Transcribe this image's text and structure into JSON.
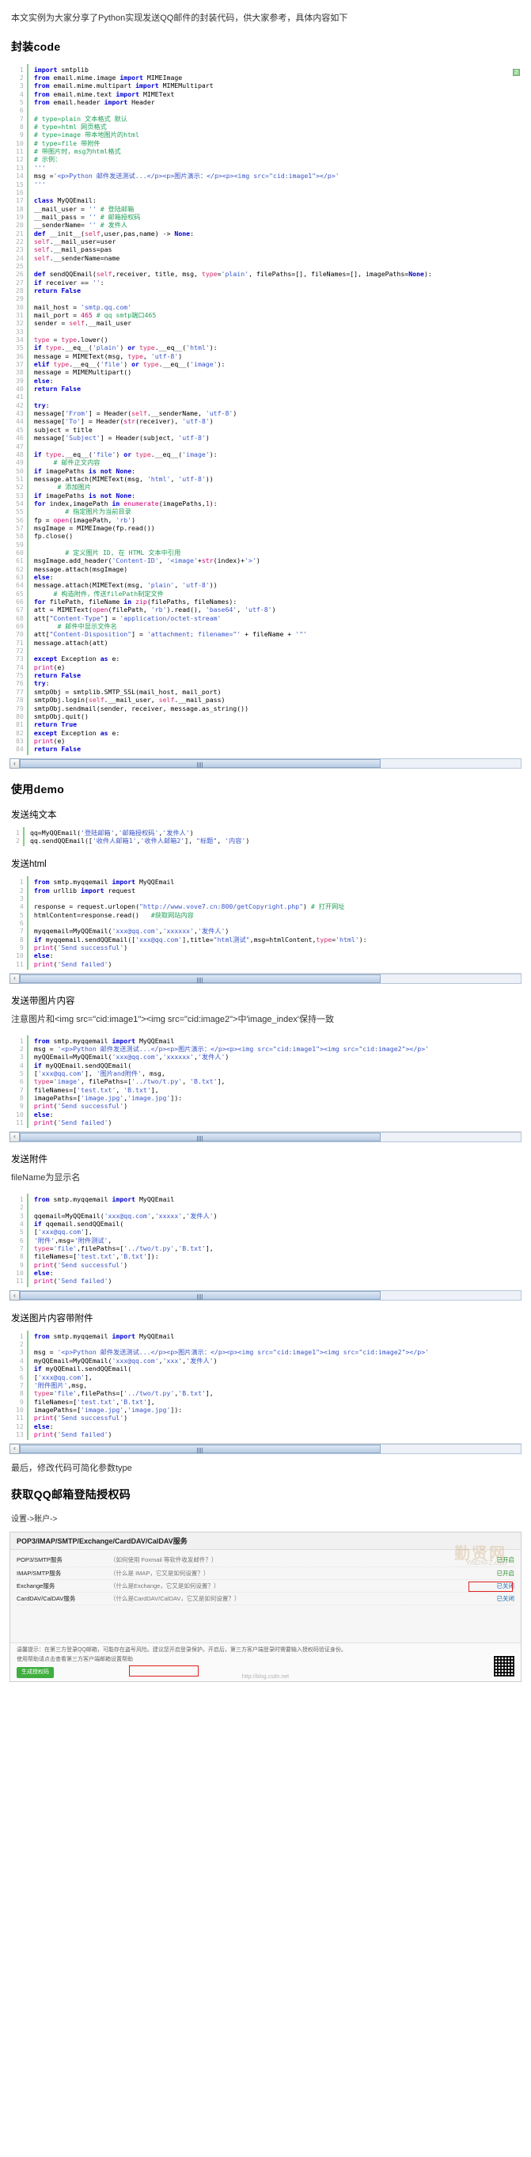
{
  "article": {
    "intro": "本文实例为大家分享了Python实现发送QQ邮件的封装代码，供大家参考，具体内容如下",
    "section1_title": "封装code",
    "section2_title": "使用demo",
    "sub_plain": "发送纯文本",
    "sub_html": "发送html",
    "sub_image": "发送带图片内容",
    "note_image": "注意图片和<img src=\"cid:image1\"><img src=\"cid:image2\">中'image_index'保持一致",
    "sub_file": "发送附件",
    "note_file": "fileName为显示名",
    "sub_image_file": "发送图片内容带附件",
    "tail_note": "最后，修改代码可简化参数type",
    "section3_title": "获取QQ邮箱登陆授权码",
    "path_note": "设置->账户->"
  },
  "scrollbar": {
    "left_arrow": "‹",
    "aria": "horizontal-scrollbar"
  },
  "badge": {
    "label": "2"
  },
  "code_blocks": {
    "main": {
      "first_line": 1,
      "lines": [
        "import smtplib",
        "from email.mime.image import MIMEImage",
        "from email.mime.multipart import MIMEMultipart",
        "from email.mime.text import MIMEText",
        "from email.header import Header",
        "",
        "# type=plain 文本格式 默认",
        "# type=html 网页格式",
        "# type=image 带本地图片的html",
        "# type=file 带附件",
        "# 带图片时，msg为html格式",
        "# 示例：",
        "'''",
        "msg ='<p>Python 邮件发送测试...</p><p>图片演示：</p><p><img src=\"cid:image1\"></p>'",
        "'''",
        "",
        "class MyQQEmail:",
        "  __mail_user = '' # 登陆邮箱",
        "  __mail_pass = '' # 邮箱授权码",
        "  __senderName= '' # 发件人",
        "  def __init__(self,user,pas,name) -> None:",
        "   self.__mail_user=user",
        "   self.__mail_pass=pas",
        "   self.__senderName=name",
        "",
        "  def sendQQEmail(self,receiver, title, msg, type='plain', filePaths=[], fileNames=[], imagePaths=None):",
        "   if receiver == '':",
        "    return False",
        "",
        "   mail_host = 'smtp.qq.com'",
        "   mail_port = 465 # qq smtp端口465",
        "   sender = self.__mail_user",
        "",
        "   type = type.lower()",
        "   if type.__eq__('plain') or type.__eq__('html'):",
        "    message = MIMEText(msg, type, 'utf-8')",
        "   elif type.__eq__('file') or type.__eq__('image'):",
        "    message = MIMEMultipart()",
        "   else:",
        "    return False",
        "",
        "   try:",
        "    message['From'] = Header(self.__senderName, 'utf-8')",
        "    message['To'] = Header(str(receiver), 'utf-8')",
        "    subject = title",
        "    message['Subject'] = Header(subject, 'utf-8')",
        "",
        "    if type.__eq__('file') or type.__eq__('image'):",
        "     # 邮件正文内容",
        "     if imagePaths is not None:",
        "      message.attach(MIMEText(msg, 'html', 'utf-8'))",
        "      # 添加图片",
        "      if imagePaths is not None:",
        "       for index,imagePath in enumerate(imagePaths,1):",
        "        # 指定图片为当前目录",
        "        fp = open(imagePath, 'rb')",
        "        msgImage = MIMEImage(fp.read())",
        "        fp.close()",
        "",
        "        # 定义图片 ID, 在 HTML 文本中引用",
        "        msgImage.add_header('Content-ID', '<image'+str(index)+'>')",
        "        message.attach(msgImage)",
        "     else:",
        "      message.attach(MIMEText(msg, 'plain', 'utf-8'))",
        "     # 构造附件，传送filePath制定文件",
        "     for filePath, fileName in zip(filePaths, fileNames):",
        "      att = MIMEText(open(filePath, 'rb').read(), 'base64', 'utf-8')",
        "      att[\"Content-Type\"] = 'application/octet-stream'",
        "      # 邮件中显示文件名",
        "      att[\"Content-Disposition\"] = 'attachment; filename=\"' + fileName + '\"'",
        "      message.attach(att)",
        "",
        "   except Exception as e:",
        "    print(e)",
        "    return False",
        "   try:",
        "    smtpObj = smtplib.SMTP_SSL(mail_host, mail_port)",
        "    smtpObj.login(self.__mail_user, self.__mail_pass)",
        "    smtpObj.sendmail(sender, receiver, message.as_string())",
        "    smtpObj.quit()",
        "    return True",
        "   except Exception as e:",
        "    print(e)",
        "    return False"
      ]
    },
    "demo_plain": {
      "first_line": 1,
      "lines": [
        "qq=MyQQEmail('登陆邮箱','邮箱授权码','发件人')",
        "qq.sendQQEmail(['收件人邮箱1','收件人邮箱2'], \"标题\", '内容')"
      ]
    },
    "demo_html": {
      "first_line": 1,
      "lines": [
        "from smtp.myqqemail import MyQQEmail",
        "from urllib import request",
        "",
        "response = request.urlopen(\"http://www.vove7.cn:800/getCopyright.php\") # 打开网址",
        "htmlContent=response.read()   #获取网站内容",
        "",
        "myqqemail=MyQQEmail('xxx@qq.com','xxxxxx','发件人')",
        "if myqqemail.sendQQEmail(['xxx@qq.com'],title=\"html测试\",msg=htmlContent,type='html'):",
        "  print('Send successful')",
        "else:",
        "  print('Send failed')"
      ]
    },
    "demo_image": {
      "first_line": 1,
      "lines": [
        "from smtp.myqqemail import MyQQEmail",
        "msg = '<p>Python 邮件发送测试...</p><p>图片演示：</p><p><img src=\"cid:image1\"><img src=\"cid:image2\"></p>'",
        "myQQEmail=MyQQEmail('xxx@qq.com','xxxxxx','发件人')",
        "if myQQEmail.sendQQEmail(",
        "    ['xxx@qq.com'], '图片and附件', msg,",
        "    type='image', filePaths=['../two/t.py', 'B.txt'],",
        "    fileNames=['test.txt', 'B.txt'],",
        "    imagePaths=['image.jpg','image.jpg']):",
        "  print('Send successful')",
        "else:",
        "  print('Send failed')"
      ]
    },
    "demo_file": {
      "first_line": 1,
      "lines": [
        "from smtp.myqqemail import MyQQEmail",
        "",
        "qqemail=MyQQEmail('xxx@qq.com','xxxxx','发件人')",
        "if qqemail.sendQQEmail(",
        "    ['xxx@qq.com'],",
        "    '附件',msg='附件测试',",
        "    type='file',filePaths=['../two/t.py','B.txt'],",
        "    fileNames=['test.txt','B.txt']):",
        "  print('Send successful')",
        "else:",
        "  print('Send failed')"
      ]
    },
    "demo_image_file": {
      "first_line": 1,
      "lines": [
        "from smtp.myqqemail import MyQQEmail",
        "",
        "msg = '<p>Python 邮件发送测试...</p><p>图片演示：</p><p><img src=\"cid:image1\"><img src=\"cid:image2\"></p>'",
        "myQQEmail=MyQQEmail('xxx@qq.com','xxx','发件人')",
        "if myQQEmail.sendQQEmail(",
        "    ['xxx@qq.com'],",
        "    '附件图片',msg,",
        "    type='file',filePaths=['../two/t.py','B.txt'],",
        "    fileNames=['test.txt','B.txt'],",
        "    imagePaths=['image.jpg','image.jpg']):",
        "  print('Send successful')",
        "else:",
        "  print('Send failed')"
      ]
    }
  },
  "screenshot": {
    "header": "POP3/IMAP/SMTP/Exchange/CardDAV/CalDAV服务",
    "rows": [
      {
        "label": "POP3/SMTP服务",
        "desc": "（如何使用 Foxmail 等软件收发邮件？）",
        "state": "已开启"
      },
      {
        "label": "IMAP/SMTP服务",
        "desc": "（什么是 IMAP，它又是如何设置？）",
        "state": "已开启"
      },
      {
        "label": "Exchange服务",
        "desc": "（什么是Exchange，它又是如何设置？）",
        "state": "已关闭"
      },
      {
        "label": "CardDAV/CalDAV服务",
        "desc": "（什么是CardDAV/CalDAV，它又是如何设置？）",
        "state": "已关闭"
      }
    ],
    "footer": "温馨提示：在第三方登录QQ邮箱，可能存在盗号风险。建议您开启登录保护。开启后，第三方客户端登录时需要输入授权码验证身份。",
    "footer2": "使用帮助请点击查看第三方客户端邮箱设置帮助",
    "generate_btn": "生成授权码",
    "watermark": "勤贤网",
    "watermark2": "YINDXFZ.com",
    "watermark3": "http://blog.csdn.net"
  }
}
